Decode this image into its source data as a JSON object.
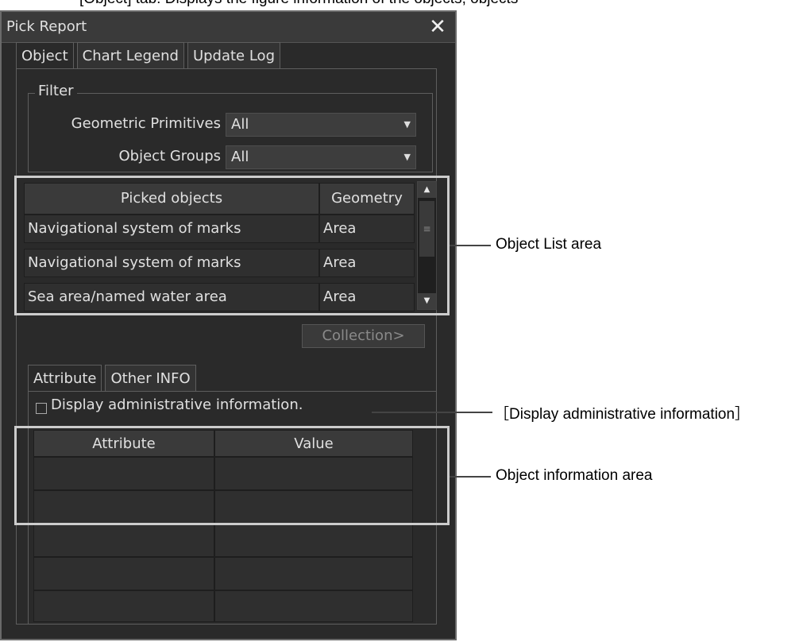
{
  "doc_header": "[Object] tab: Displays the figure information of the objects, objects",
  "window": {
    "title": "Pick Report",
    "close_symbol": "✕"
  },
  "tabs": [
    "Object",
    "Chart Legend",
    "Update Log"
  ],
  "filter": {
    "legend": "Filter",
    "geometric_primitives": {
      "label": "Geometric Primitives",
      "value": "All"
    },
    "object_groups": {
      "label": "Object Groups",
      "value": "All"
    }
  },
  "object_table": {
    "headers": [
      "Picked objects",
      "Geometry"
    ],
    "rows": [
      [
        "Navigational system of marks",
        "Area"
      ],
      [
        "Navigational system of marks",
        "Area"
      ],
      [
        "Sea area/named water area",
        "Area"
      ]
    ]
  },
  "collection_button": "Collection>",
  "sub_tabs": [
    "Attribute",
    "Other INFO"
  ],
  "admin_checkbox": {
    "label": "Display administrative information.",
    "checked": false
  },
  "attr_table": {
    "headers": [
      "Attribute",
      "Value"
    ],
    "rows": [
      [
        "",
        ""
      ],
      [
        "",
        ""
      ],
      [
        "",
        ""
      ],
      [
        "",
        ""
      ],
      [
        "",
        ""
      ],
      [
        "",
        ""
      ]
    ]
  },
  "callouts": {
    "object_list": "Object List area",
    "admin_info": "［Display administrative information］",
    "object_info": "Object information area"
  },
  "colors": {
    "window_bg": "#2a2a2a",
    "text": "#e0e0e0",
    "highlight": "#cccccc"
  }
}
